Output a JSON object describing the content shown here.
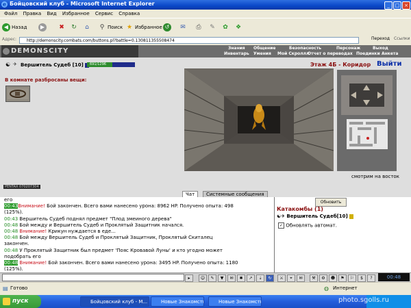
{
  "window": {
    "title": "Бойцовский клуб - Microsoft Internet Explorer",
    "buttons": [
      "_",
      "□",
      "×"
    ]
  },
  "menu": [
    "Файл",
    "Правка",
    "Вид",
    "Избранное",
    "Сервис",
    "Справка"
  ],
  "toolbar": {
    "back": "Назад",
    "search": "Поиск",
    "favorites": "Избранное"
  },
  "address": {
    "label": "Адрес:",
    "url": "http://demonscity.combats.com/buttons.pl?battle=0.130811355508474",
    "go": "Переход",
    "links": "Ссылки"
  },
  "game": {
    "logo": "DEMONSCITY",
    "nav_top": [
      "Знания",
      "Общение",
      "Безопасность",
      "Персонаж",
      "Выход"
    ],
    "nav_bottom": [
      "Инвентарь",
      "Умения",
      "Мой Скроллл",
      "Отчет о переводах",
      "Поединки",
      "Анкета"
    ],
    "character": {
      "name": "Вершитель Судеб",
      "level": "[10]",
      "hp_text": "691/1296",
      "hp_fraction": 0.53
    },
    "items_header": "В комнате разбросаны вещи:",
    "floor": "Этаж 4Б - Коридор",
    "exit": "Выйти",
    "facing": "смотрим на восток",
    "footer_label": "PENTAX 070207304"
  },
  "tabs": {
    "chat": "Чат",
    "system": "Системные сообщения"
  },
  "chat": [
    {
      "time": "",
      "text": "его"
    },
    {
      "time": "00:43",
      "hl": true,
      "warn": "Внимание!",
      "text": " Бой закончен. Всего вами нанесено урона: 8962 HP. Получено опыта: 498"
    },
    {
      "time": "",
      "text": "(125%)."
    },
    {
      "time": "00:43",
      "text": " Вершитель Судеб поднял предмет \"Плод змеиного дерева\""
    },
    {
      "time": "00:48",
      "text": " Бой между и Вершитель Судеб и Проклятый Защитник начался."
    },
    {
      "time": "00:48",
      "warn": "Внимание!",
      "text": " Крикун нуждается в еде..."
    },
    {
      "time": "00:48",
      "text": " Бой между Вершитель Судеб и Проклятый Защитник, Проклятый Скиталец"
    },
    {
      "time": "",
      "text": "закончен."
    },
    {
      "time": "00:48",
      "text": " У Проклятый Защитник был предмет 'Пояс Кровавой Луны' и кто угодно может"
    },
    {
      "time": "",
      "text": "подобрать его"
    },
    {
      "time": "00:48",
      "hl": true,
      "warn": "Внимание!",
      "text": " Бой закончен. Всего вами нанесено урона: 3495 HP. Получено опыта: 1180"
    },
    {
      "time": "",
      "text": "(125%)."
    }
  ],
  "right_panel": {
    "refresh": "Обновить",
    "location": "Катакомбы (1)",
    "player": "Вершитель Судеб[10]",
    "auto_refresh": "Обновлять автомат."
  },
  "clock": "00:48",
  "status": {
    "left": "Готово",
    "zone": "Интернет"
  },
  "taskbar": {
    "start": "пуск",
    "tasks": [
      "Бойцовский клуб - M...",
      "Новые Знакомства /...",
      "Новые Знакомства /..."
    ]
  },
  "watermark": "photo.sgolls.ru"
}
